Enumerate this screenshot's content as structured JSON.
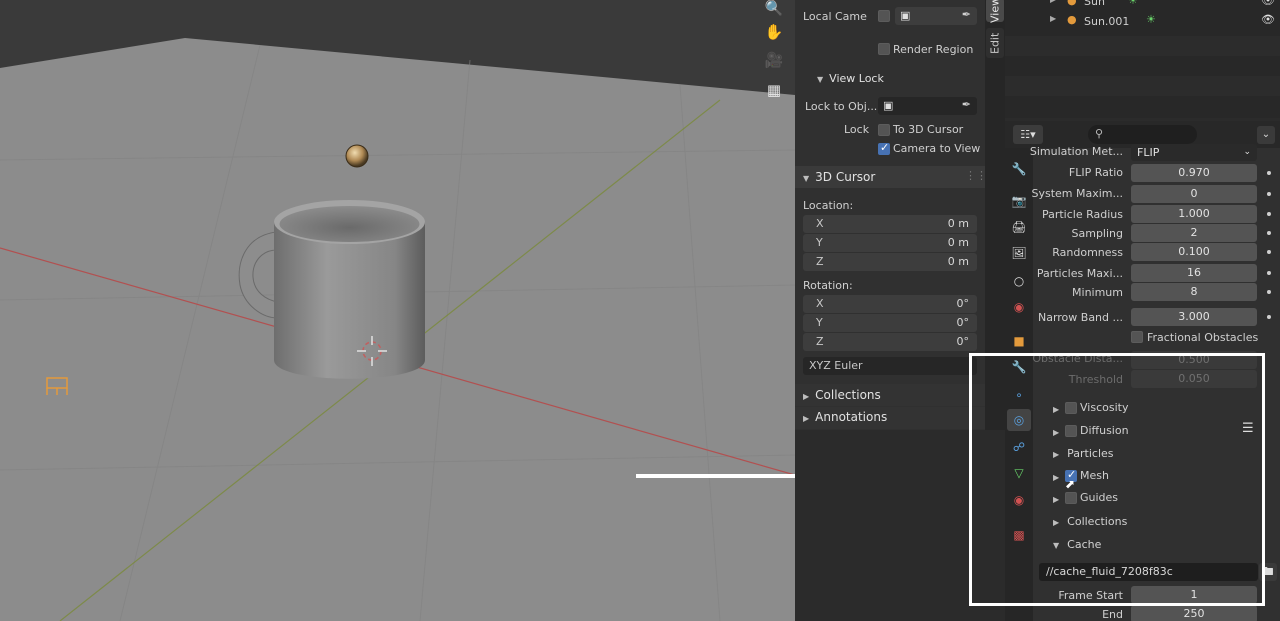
{
  "colors": {
    "accent": "#4772b3",
    "annotation": "#ffffff",
    "viewport_floor": "#8c8c8c",
    "x_axis": "#b25050",
    "y_axis": "#7a8a3a",
    "outliner_light_icon": "#69d36a"
  },
  "npanel": {
    "view": {
      "local_camera_label": "Local Came",
      "render_region_label": "Render Region",
      "view_lock_title": "View Lock",
      "lock_to_object_label": "Lock to Obj...",
      "lock_label": "Lock",
      "to_3d_cursor_label": "To 3D Cursor",
      "to_3d_cursor_checked": false,
      "camera_to_view_label": "Camera to View",
      "camera_to_view_checked": true
    },
    "cursor": {
      "title": "3D Cursor",
      "location_label": "Location:",
      "location": [
        {
          "axis": "X",
          "value": "0 m"
        },
        {
          "axis": "Y",
          "value": "0 m"
        },
        {
          "axis": "Z",
          "value": "0 m"
        }
      ],
      "rotation_label": "Rotation:",
      "rotation": [
        {
          "axis": "X",
          "value": "0°"
        },
        {
          "axis": "Y",
          "value": "0°"
        },
        {
          "axis": "Z",
          "value": "0°"
        }
      ],
      "rotation_mode": "XYZ Euler"
    },
    "collections_title": "Collections",
    "annotations_title": "Annotations",
    "tabs": [
      "View",
      "Edit"
    ]
  },
  "outliner": {
    "items": [
      {
        "name": "Sun",
        "icon": "light-icon"
      },
      {
        "name": "Sun.001",
        "icon": "light-icon"
      }
    ]
  },
  "properties": {
    "search_placeholder": "",
    "simulation_method_label": "Simulation Met...",
    "simulation_method_value": "FLIP",
    "rows": [
      {
        "label": "FLIP Ratio",
        "value": "0.970"
      },
      {
        "label": "System Maxim...",
        "value": "0"
      },
      {
        "label": "Particle Radius",
        "value": "1.000"
      },
      {
        "label": "Sampling",
        "value": "2"
      },
      {
        "label": "Randomness",
        "value": "0.100"
      },
      {
        "label": "Particles Maxi...",
        "value": "16"
      },
      {
        "label": "Minimum",
        "value": "8"
      },
      {
        "label": "Narrow Band ...",
        "value": "3.000"
      }
    ],
    "fractional_obstacles_label": "Fractional Obstacles",
    "obstacle_distance_label": "Obstacle Dista...",
    "obstacle_distance_value": "0.500",
    "threshold_label": "Threshold",
    "threshold_value": "0.050",
    "subpanels": [
      {
        "label": "Viscosity",
        "checkbox": true,
        "checked": false
      },
      {
        "label": "Diffusion",
        "checkbox": true,
        "checked": false
      },
      {
        "label": "Particles",
        "checkbox": false,
        "checked": false
      },
      {
        "label": "Mesh",
        "checkbox": true,
        "checked": true
      },
      {
        "label": "Guides",
        "checkbox": true,
        "checked": false
      },
      {
        "label": "Collections",
        "checkbox": false,
        "checked": false
      },
      {
        "label": "Cache",
        "checkbox": false,
        "checked": false,
        "expanded": true
      }
    ],
    "cache_directory": "//cache_fluid_7208f83c",
    "frame_start_label": "Frame Start",
    "frame_start_value": "1",
    "end_label": "End",
    "end_value": "250"
  }
}
